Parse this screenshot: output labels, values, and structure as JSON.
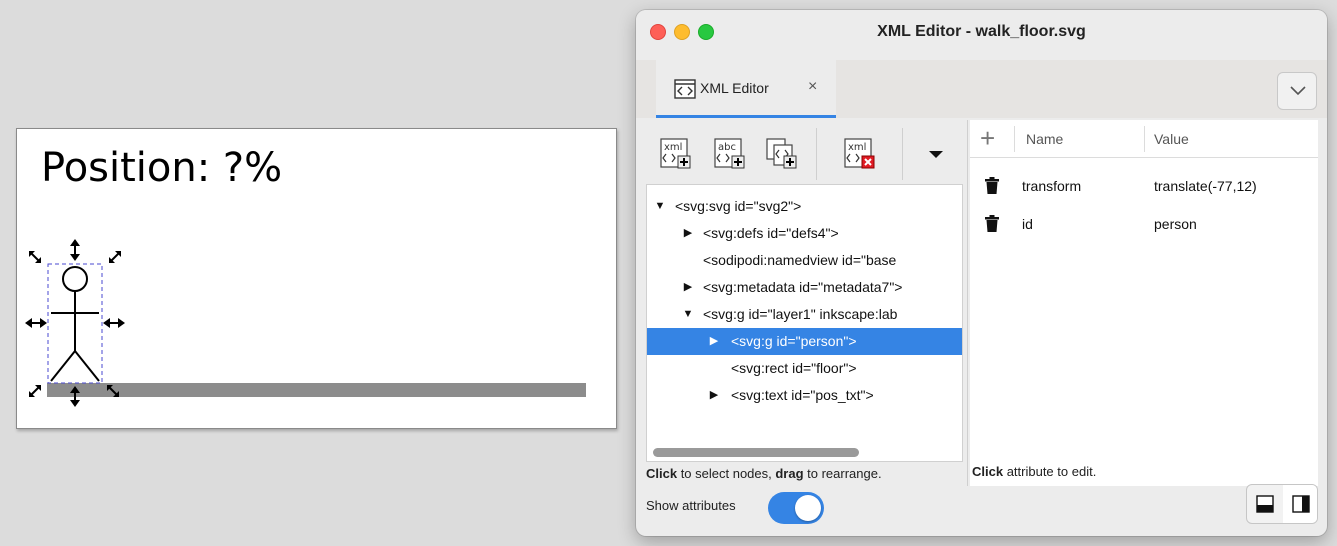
{
  "canvas": {
    "position_text": "Position: ?%"
  },
  "window": {
    "title": "XML Editor - walk_floor.svg"
  },
  "tab": {
    "label": "XML Editor",
    "close": "×"
  },
  "toolbar": {
    "new_element_icon": "xml-new-element-icon",
    "new_text_icon": "abc-new-text-node-icon",
    "duplicate_icon": "duplicate-node-icon",
    "delete_icon": "xml-delete-node-icon",
    "more_icon": "dropdown-triangle-icon",
    "new_element_label": "xml",
    "new_text_label": "abc",
    "delete_label": "xml"
  },
  "tree": {
    "nodes": [
      {
        "text": "<svg:svg id=\"svg2\">",
        "expander": "▼"
      },
      {
        "text": "<svg:defs id=\"defs4\">",
        "expander": "▶"
      },
      {
        "text": "<sodipodi:namedview id=\"base",
        "expander": ""
      },
      {
        "text": "<svg:metadata id=\"metadata7\">",
        "expander": "▶"
      },
      {
        "text": "<svg:g id=\"layer1\" inkscape:lab",
        "expander": "▼"
      },
      {
        "text": "<svg:g id=\"person\">",
        "expander": "▶"
      },
      {
        "text": "<svg:rect id=\"floor\">",
        "expander": ""
      },
      {
        "text": "<svg:text id=\"pos_txt\">",
        "expander": "▶"
      }
    ]
  },
  "left_hint": {
    "bold": "Click",
    "mid": " to select nodes, ",
    "bold2": "drag",
    "end": " to rearrange."
  },
  "show_attributes": {
    "label": "Show attributes",
    "enabled": true
  },
  "attributes": {
    "add": "+",
    "header_name": "Name",
    "header_value": "Value",
    "rows": [
      {
        "name": "transform",
        "value": "translate(-77,12)"
      },
      {
        "name": "id",
        "value": "person"
      }
    ]
  },
  "right_hint": {
    "bold": "Click",
    "rest": " attribute to edit."
  },
  "colors": {
    "accent": "#3584e4",
    "floor": "#8c8c8c"
  }
}
